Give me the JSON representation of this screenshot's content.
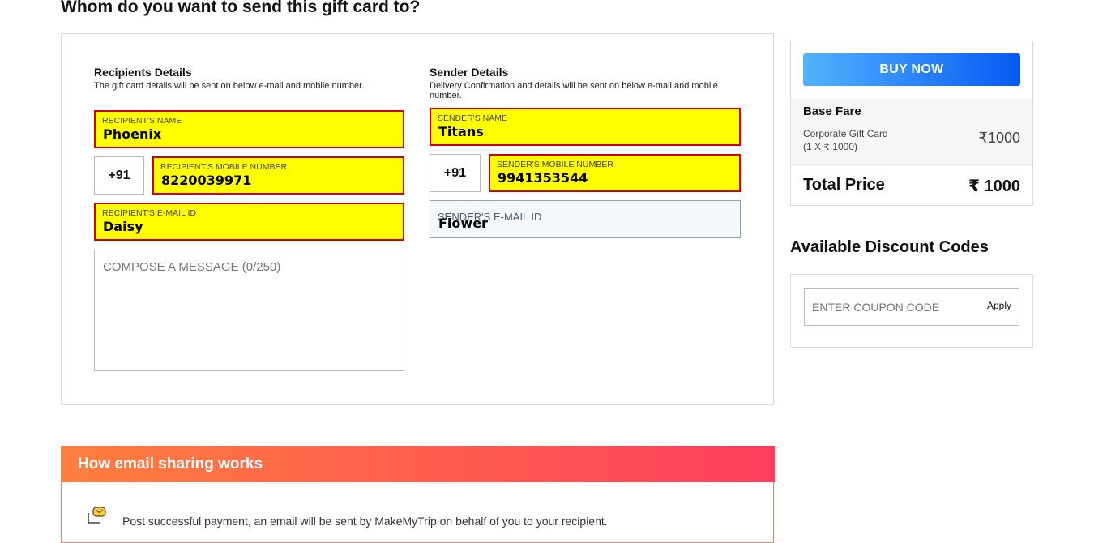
{
  "page_heading": "Whom do you want to send this gift card to?",
  "recipients": {
    "title": "Recipients Details",
    "subtitle": "The gift card details will be sent on below e-mail and mobile number.",
    "name_label": "RECIPIENT'S NAME",
    "name_value": "Phoenix",
    "country_code": "+91",
    "mobile_label": "RECIPIENT'S MOBILE NUMBER",
    "mobile_value": "8220039971",
    "email_label": "RECIPIENT'S E-MAIL ID",
    "email_value": "Daisy",
    "message_placeholder": "COMPOSE A MESSAGE (0/250)"
  },
  "sender": {
    "title": "Sender Details",
    "subtitle": "Delivery Confirmation and details will be sent on below e-mail and mobile number.",
    "name_label": "SENDER'S NAME",
    "name_value": "Titans",
    "country_code": "+91",
    "mobile_label": "SENDER'S MOBILE NUMBER",
    "mobile_value": "9941353544",
    "email_label": "SENDER'S E-MAIL ID",
    "email_value": "Flower"
  },
  "summary": {
    "buy_label": "BUY NOW",
    "fare_title": "Base Fare",
    "fare_item": "Corporate Gift Card",
    "fare_qty": "(1 X ₹ 1000)",
    "fare_amount": "₹1000",
    "total_label": "Total Price",
    "total_amount": "₹ 1000"
  },
  "discount": {
    "heading": "Available Discount Codes",
    "placeholder": "ENTER COUPON CODE",
    "apply_label": "Apply"
  },
  "how_it_works": {
    "title": "How email sharing works",
    "text": "Post successful payment, an email will be sent by MakeMyTrip on behalf of you to your recipient."
  },
  "colors": {
    "field_highlight": "#ffff00",
    "field_border": "#cc0000",
    "buy_gradient_start": "#53b2fe",
    "buy_gradient_end": "#065af3",
    "how_gradient_start": "#ff7f3f",
    "how_gradient_end": "#ff3e5e"
  }
}
